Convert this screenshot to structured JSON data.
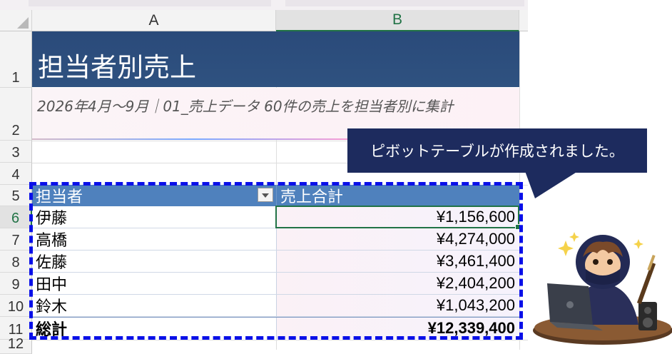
{
  "spreadsheet": {
    "columns": [
      "A",
      "B"
    ],
    "rows": [
      "1",
      "2",
      "3",
      "4",
      "5",
      "6",
      "7",
      "8",
      "9",
      "10",
      "11",
      "12"
    ],
    "active_row": "6",
    "active_column": "B"
  },
  "report": {
    "title": "担当者別売上",
    "subtitle": "2026年4月〜9月｜01_売上データ 60件の売上を担当者別に集計"
  },
  "pivot": {
    "header_name": "担当者",
    "header_value": "売上合計",
    "rows": [
      {
        "name": "伊藤",
        "value": "¥1,156,600"
      },
      {
        "name": "高橋",
        "value": "¥4,274,000"
      },
      {
        "name": "佐藤",
        "value": "¥3,461,400"
      },
      {
        "name": "田中",
        "value": "¥2,404,200"
      },
      {
        "name": "鈴木",
        "value": "¥1,043,200"
      }
    ],
    "total_name": "総計",
    "total_value": "¥12,339,400"
  },
  "callout": {
    "text": "ピボットテーブルが作成されました。"
  },
  "colors": {
    "title_bg": "#2f5280",
    "pivot_header_bg": "#4f81bd",
    "selection": "#217346",
    "dash_border": "#0a10e8",
    "callout_bg": "#1d2b5e"
  },
  "icons": [
    "filter-dropdown-icon",
    "ninja-mascot-icon"
  ]
}
